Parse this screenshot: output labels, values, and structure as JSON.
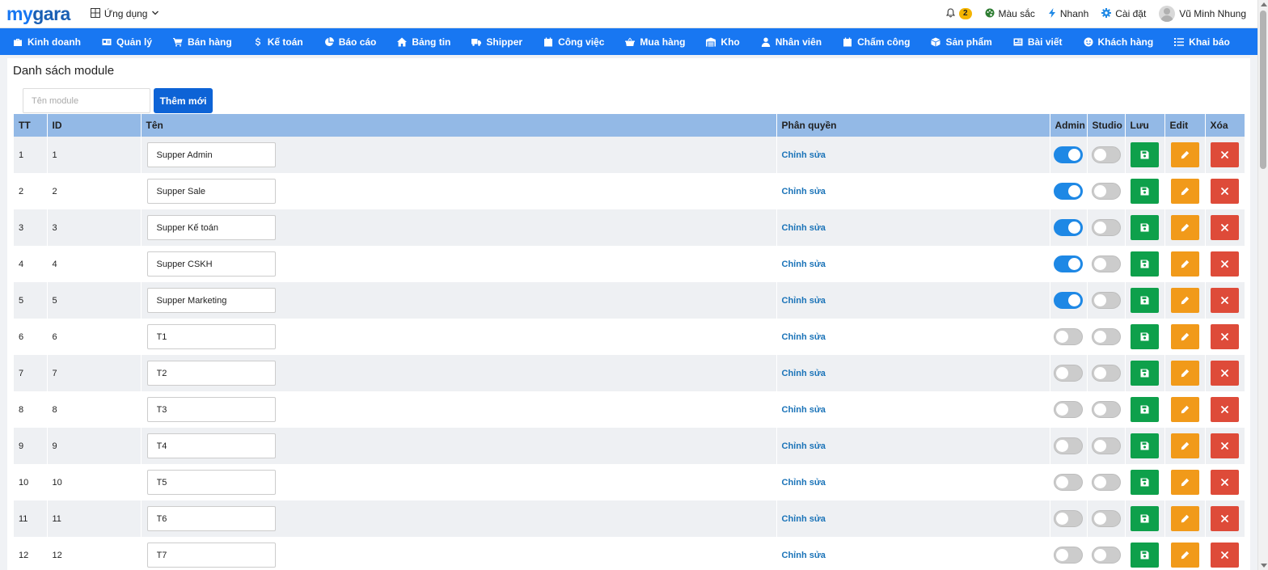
{
  "header": {
    "logo_my": "my",
    "logo_gara": "gara",
    "apps_label": "Ứng dụng",
    "notification_count": "2",
    "color_label": "Màu sắc",
    "branch_label": "Nhanh",
    "settings_label": "Cài đặt",
    "user_name": "Vũ Minh Nhung"
  },
  "nav": {
    "items": [
      {
        "label": "Kinh doanh",
        "icon": "briefcase-icon"
      },
      {
        "label": "Quản lý",
        "icon": "id-card-icon"
      },
      {
        "label": "Bán hàng",
        "icon": "cart-icon"
      },
      {
        "label": "Kế toán",
        "icon": "dollar-icon"
      },
      {
        "label": "Báo cáo",
        "icon": "pie-chart-icon"
      },
      {
        "label": "Bảng tin",
        "icon": "home-icon"
      },
      {
        "label": "Shipper",
        "icon": "truck-icon"
      },
      {
        "label": "Công việc",
        "icon": "calendar-icon"
      },
      {
        "label": "Mua hàng",
        "icon": "basket-icon"
      },
      {
        "label": "Kho",
        "icon": "warehouse-icon"
      },
      {
        "label": "Nhân viên",
        "icon": "user-icon"
      },
      {
        "label": "Chấm công",
        "icon": "calendar-icon"
      },
      {
        "label": "Sản phẩm",
        "icon": "box-icon"
      },
      {
        "label": "Bài viết",
        "icon": "newspaper-icon"
      },
      {
        "label": "Khách hàng",
        "icon": "smile-icon"
      },
      {
        "label": "Khai báo",
        "icon": "list-icon"
      }
    ]
  },
  "page": {
    "title": "Danh sách module",
    "input_placeholder": "Tên module",
    "add_button": "Thêm mới"
  },
  "table": {
    "headers": [
      "TT",
      "ID",
      "Tên",
      "Phân quyền",
      "Admin",
      "Studio",
      "Lưu",
      "Edit",
      "Xóa"
    ],
    "link_label": "Chỉnh sửa",
    "rows": [
      {
        "tt": "1",
        "id": "1",
        "name": "Supper Admin",
        "admin": true,
        "studio": false
      },
      {
        "tt": "2",
        "id": "2",
        "name": "Supper Sale",
        "admin": true,
        "studio": false
      },
      {
        "tt": "3",
        "id": "3",
        "name": "Supper Kế toán",
        "admin": true,
        "studio": false
      },
      {
        "tt": "4",
        "id": "4",
        "name": "Supper CSKH",
        "admin": true,
        "studio": false
      },
      {
        "tt": "5",
        "id": "5",
        "name": "Supper Marketing",
        "admin": true,
        "studio": false
      },
      {
        "tt": "6",
        "id": "6",
        "name": "T1",
        "admin": false,
        "studio": false
      },
      {
        "tt": "7",
        "id": "7",
        "name": "T2",
        "admin": false,
        "studio": false
      },
      {
        "tt": "8",
        "id": "8",
        "name": "T3",
        "admin": false,
        "studio": false
      },
      {
        "tt": "9",
        "id": "9",
        "name": "T4",
        "admin": false,
        "studio": false
      },
      {
        "tt": "10",
        "id": "10",
        "name": "T5",
        "admin": false,
        "studio": false
      },
      {
        "tt": "11",
        "id": "11",
        "name": "T6",
        "admin": false,
        "studio": false
      },
      {
        "tt": "12",
        "id": "12",
        "name": "T7",
        "admin": false,
        "studio": false
      }
    ]
  },
  "colors": {
    "primary": "#1877f2",
    "header_row": "#93b9e6",
    "save": "#0ea04b",
    "edit": "#f19a1a",
    "delete": "#de4b39",
    "toggle_on": "#1e88e5"
  }
}
